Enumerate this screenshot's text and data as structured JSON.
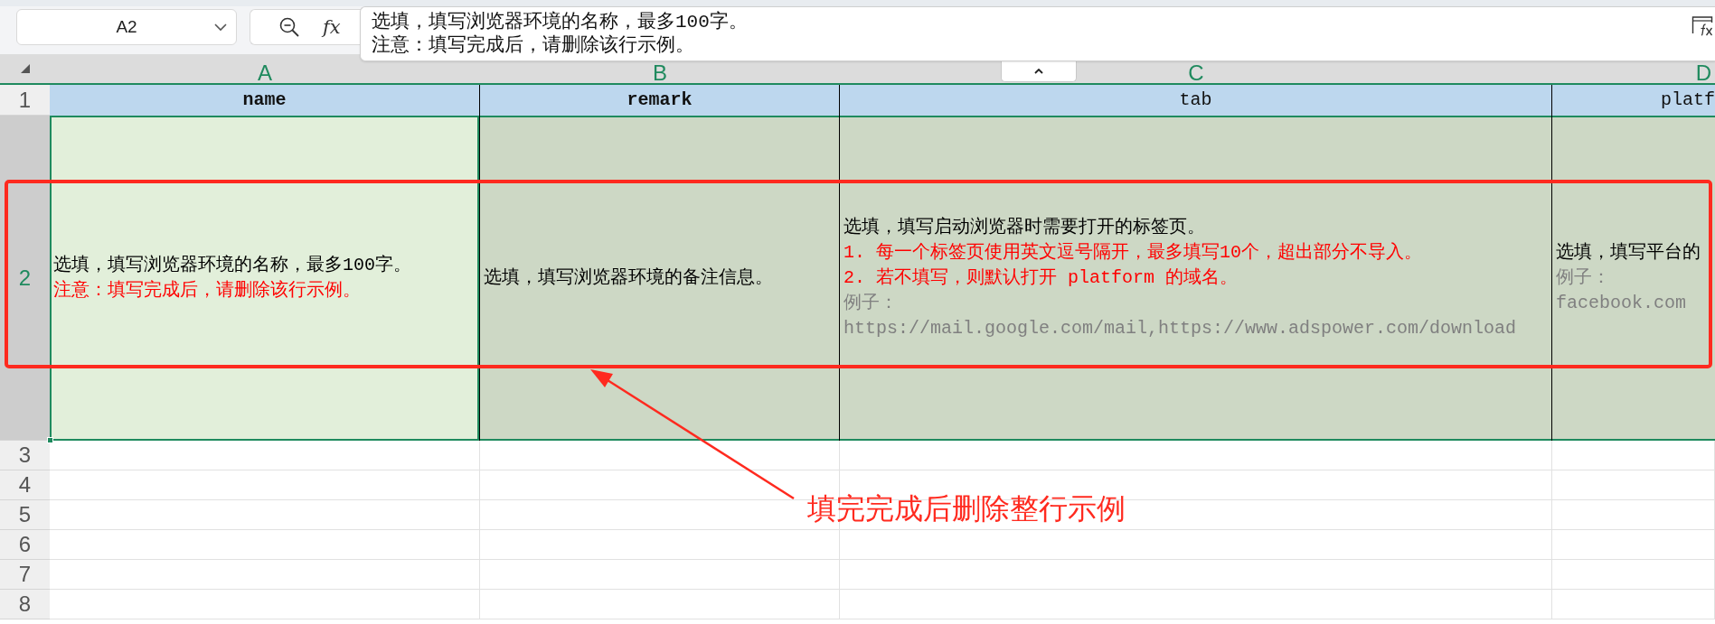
{
  "name_box": {
    "value": "A2"
  },
  "formula_bar": {
    "function_label": "fx",
    "content_lines": [
      "选填，填写浏览器环境的名称，最多100字。",
      "注意：填写完成后，请删除该行示例。"
    ]
  },
  "columns": [
    {
      "letter": "A",
      "selected": true
    },
    {
      "letter": "B",
      "selected": true
    },
    {
      "letter": "C",
      "selected": true
    },
    {
      "letter": "D",
      "selected": true
    }
  ],
  "rows": [
    {
      "number": "1",
      "kind": "header",
      "selected": false,
      "cells": [
        {
          "text": "name",
          "bold": true
        },
        {
          "text": "remark",
          "bold": true
        },
        {
          "text": "tab",
          "bold": false
        },
        {
          "text": "platf",
          "bold": false
        }
      ]
    },
    {
      "number": "2",
      "kind": "example",
      "selected": true,
      "cells": [
        {
          "active": true,
          "lines": [
            {
              "kind": "instruction",
              "text": "选填，填写浏览器环境的名称，最多100字。"
            },
            {
              "kind": "warning",
              "text": "注意：填写完成后，请删除该行示例。"
            }
          ]
        },
        {
          "active": false,
          "lines": [
            {
              "kind": "instruction",
              "text": "选填，填写浏览器环境的备注信息。"
            }
          ]
        },
        {
          "active": false,
          "lines": [
            {
              "kind": "instruction",
              "text": "选填，填写启动浏览器时需要打开的标签页。"
            },
            {
              "kind": "warning",
              "text": "1. 每一个标签页使用英文逗号隔开，最多填写10个，超出部分不导入。"
            },
            {
              "kind": "warning",
              "text": "2. 若不填写，则默认打开 platform 的域名。"
            },
            {
              "kind": "example",
              "text": "例子："
            },
            {
              "kind": "example",
              "text": "https://mail.google.com/mail,https://www.adspower.com/download"
            }
          ]
        },
        {
          "active": false,
          "lines": [
            {
              "kind": "instruction",
              "text": "选填，填写平台的"
            },
            {
              "kind": "example",
              "text": "例子："
            },
            {
              "kind": "example",
              "text": "facebook.com"
            }
          ]
        }
      ]
    },
    {
      "number": "3",
      "kind": "empty",
      "selected": false
    },
    {
      "number": "4",
      "kind": "empty",
      "selected": false
    },
    {
      "number": "5",
      "kind": "empty",
      "selected": false
    },
    {
      "number": "6",
      "kind": "empty",
      "selected": false
    },
    {
      "number": "7",
      "kind": "empty",
      "selected": false
    },
    {
      "number": "8",
      "kind": "empty",
      "selected": false
    }
  ],
  "annotation": {
    "label": "填完完成后删除整行示例"
  }
}
